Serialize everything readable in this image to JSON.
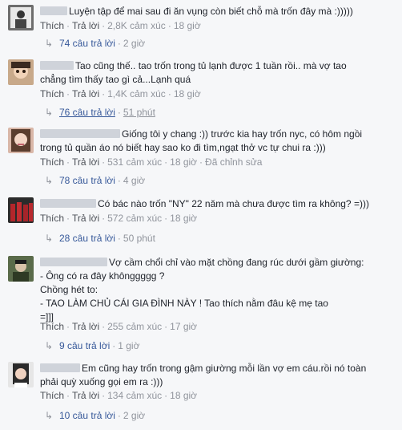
{
  "comments": [
    {
      "text_lines": [
        "Luyện tập để mai sau đi ăn vụng còn biết chỗ mà trốn đây mà :)))))"
      ],
      "like_label": "Thích",
      "reply_label": "Trả lời",
      "reactions": "2,8K cảm xúc",
      "time": "18 giờ",
      "replies_label": "74 câu trả lời",
      "replies_time": "2 giờ"
    },
    {
      "text_lines": [
        "Tao cũng thế.. tao trốn trong tủ lạnh được 1 tuần rồi.. mà vợ tao",
        "chẳng tìm thấy tao gì cả...Lạnh quá"
      ],
      "like_label": "Thích",
      "reply_label": "Trả lời",
      "reactions": "1,4K cảm xúc",
      "time": "18 giờ",
      "replies_label": "76 câu trả lời",
      "replies_time": "51 phút"
    },
    {
      "text_lines": [
        "Giống tôi y chang :)) trước kia hay trốn nyc, có hôm ngồi",
        "trong tủ quần áo nó biết hay sao ko đi tìm,ngạt thở vc tự chui ra :)))"
      ],
      "like_label": "Thích",
      "reply_label": "Trả lời",
      "reactions": "531 cảm xúc",
      "time": "18 giờ",
      "edited": "Đã chỉnh sửa",
      "replies_label": "78 câu trả lời",
      "replies_time": "4 giờ"
    },
    {
      "text_lines": [
        "Có bác nào trốn \"NY\" 22 năm mà chưa được tìm ra không? =)))"
      ],
      "like_label": "Thích",
      "reply_label": "Trả lời",
      "reactions": "572 cảm xúc",
      "time": "18 giờ",
      "replies_label": "28 câu trả lời",
      "replies_time": "50 phút"
    },
    {
      "text_lines": [
        "Vợ cầm chổi chỉ vào mặt chồng đang rúc dưới gầm giường:",
        "- Ông có ra đây khônggggg ?",
        "Chồng hét to:",
        "- TAO LÀM CHỦ CÁI GIA ĐÌNH NÀY ! Tao thích nằm đâu kệ mẹ tao",
        "=]]]"
      ],
      "like_label": "Thích",
      "reply_label": "Trả lời",
      "reactions": "255 cảm xúc",
      "time": "17 giờ",
      "replies_label": "9 câu trả lời",
      "replies_time": "1 giờ"
    },
    {
      "text_lines": [
        "Em cũng hay trốn trong gậm giường mỗi lần vợ em cáu.rồi nó toàn",
        "phải quỳ xuống gọi em ra :)))"
      ],
      "like_label": "Thích",
      "reply_label": "Trả lời",
      "reactions": "134 cảm xúc",
      "time": "18 giờ",
      "replies_label": "10 câu trả lời",
      "replies_time": "2 giờ"
    }
  ],
  "reply_icon": "reply-arrow-icon",
  "colors": {
    "link": "#365899",
    "meta": "#90949c",
    "text": "#1d2129",
    "background": "#f6f7f9"
  }
}
